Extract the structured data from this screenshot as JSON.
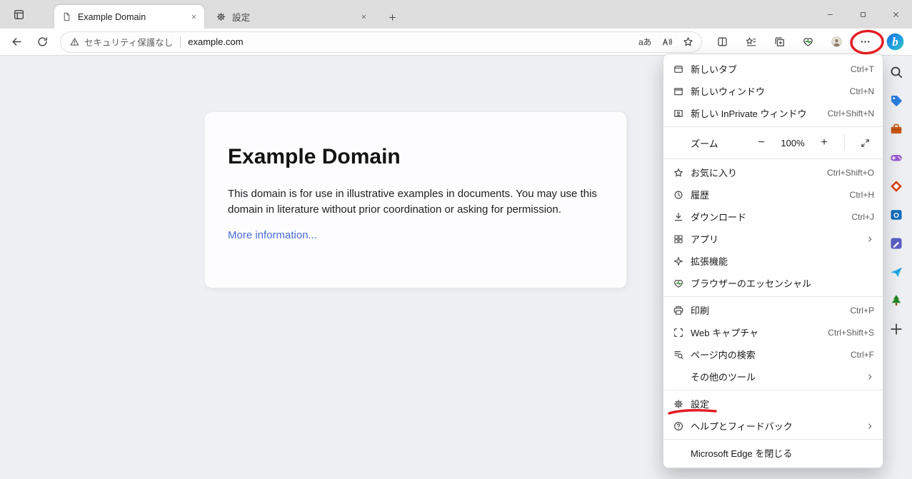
{
  "colors": {
    "annotation_red": "#e31b23",
    "link_blue": "#4a6cd4"
  },
  "titlebar": {
    "tabs": [
      {
        "id": "example-domain",
        "label": "Example Domain",
        "favicon": "page-icon",
        "active": true
      },
      {
        "id": "settings",
        "label": "設定",
        "favicon": "gear-icon",
        "active": false
      }
    ],
    "window_controls": [
      {
        "id": "minimize",
        "icon": "minimize-icon"
      },
      {
        "id": "maximize",
        "icon": "maximize-icon"
      },
      {
        "id": "close",
        "icon": "close-window-icon"
      }
    ]
  },
  "toolbar": {
    "address_bar": {
      "security_label": "セキュリティ保護なし",
      "url": "example.com",
      "inline_buttons": [
        {
          "id": "translate",
          "icon": "translate-icon",
          "label": "aあ"
        },
        {
          "id": "read-aloud",
          "icon": "read-aloud-icon"
        },
        {
          "id": "add-favorite",
          "icon": "favorite-star-icon"
        }
      ]
    },
    "buttons": [
      {
        "id": "split-screen",
        "icon": "split-screen-icon"
      },
      {
        "id": "favorites-hub",
        "icon": "favorites-hub-icon"
      },
      {
        "id": "collections",
        "icon": "collections-icon"
      },
      {
        "id": "browser-essentials",
        "icon": "browser-essentials-icon"
      },
      {
        "id": "profile",
        "icon": "profile-avatar-icon"
      },
      {
        "id": "more-menu",
        "icon": "more-menu-icon"
      }
    ],
    "copilot": {
      "id": "copilot",
      "icon": "copilot-icon"
    }
  },
  "sidebar": {
    "items": [
      {
        "id": "search",
        "icon": "sidebar-search-icon"
      },
      {
        "id": "shopping",
        "icon": "shopping-icon"
      },
      {
        "id": "toolbox",
        "icon": "toolbox-icon"
      },
      {
        "id": "games",
        "icon": "games-icon"
      },
      {
        "id": "microsoft-365",
        "icon": "m365-icon"
      },
      {
        "id": "outlook",
        "icon": "outlook-icon"
      },
      {
        "id": "designer",
        "icon": "designer-icon"
      },
      {
        "id": "drop",
        "icon": "drop-icon"
      },
      {
        "id": "grow-tree",
        "icon": "grow-tree-icon"
      },
      {
        "id": "add",
        "icon": "sidebar-plus-icon"
      }
    ]
  },
  "page": {
    "heading": "Example Domain",
    "body": "This domain is for use in illustrative examples in documents. You may use this domain in literature without prior coordination or asking for permission.",
    "link_label": "More information..."
  },
  "menu": {
    "items": [
      {
        "type": "item",
        "id": "new-tab",
        "icon": "new-tab-icon",
        "label": "新しいタブ",
        "shortcut": "Ctrl+T"
      },
      {
        "type": "item",
        "id": "new-window",
        "icon": "new-window-icon",
        "label": "新しいウィンドウ",
        "shortcut": "Ctrl+N"
      },
      {
        "type": "item",
        "id": "new-inprivate-window",
        "icon": "inprivate-icon",
        "label": "新しい InPrivate ウィンドウ",
        "shortcut": "Ctrl+Shift+N"
      },
      {
        "type": "separator"
      },
      {
        "type": "zoom",
        "id": "zoom",
        "label": "ズーム",
        "minus": "−",
        "zoom_value": "100%",
        "plus": "+",
        "fullscreen_icon": "expand-icon"
      },
      {
        "type": "separator"
      },
      {
        "type": "item",
        "id": "favorites",
        "icon": "favorites-menu-icon",
        "label": "お気に入り",
        "shortcut": "Ctrl+Shift+O"
      },
      {
        "type": "item",
        "id": "history",
        "icon": "history-icon",
        "label": "履歴",
        "shortcut": "Ctrl+H"
      },
      {
        "type": "item",
        "id": "downloads",
        "icon": "download-icon",
        "label": "ダウンロード",
        "shortcut": "Ctrl+J"
      },
      {
        "type": "item",
        "id": "apps",
        "icon": "apps-icon",
        "label": "アプリ",
        "submenu": true
      },
      {
        "type": "item",
        "id": "extensions",
        "icon": "extensions-icon",
        "label": "拡張機能"
      },
      {
        "type": "item",
        "id": "browser-essentials",
        "icon": "essentials-menu-icon",
        "label": "ブラウザーのエッセンシャル"
      },
      {
        "type": "separator"
      },
      {
        "type": "item",
        "id": "print",
        "icon": "print-icon",
        "label": "印刷",
        "shortcut": "Ctrl+P"
      },
      {
        "type": "item",
        "id": "web-capture",
        "icon": "web-capture-icon",
        "label": "Web キャプチャ",
        "shortcut": "Ctrl+Shift+S"
      },
      {
        "type": "item",
        "id": "find-on-page",
        "icon": "find-icon",
        "label": "ページ内の検索",
        "shortcut": "Ctrl+F"
      },
      {
        "type": "item",
        "id": "more-tools",
        "icon": "",
        "label": "その他のツール",
        "submenu": true
      },
      {
        "type": "separator"
      },
      {
        "type": "item",
        "id": "settings",
        "icon": "settings-gear-icon",
        "label": "設定",
        "annotated": true
      },
      {
        "type": "item",
        "id": "help-feedback",
        "icon": "help-icon",
        "label": "ヘルプとフィードバック",
        "submenu": true
      },
      {
        "type": "separator"
      },
      {
        "type": "item",
        "id": "close-edge",
        "icon": "",
        "label": "Microsoft Edge を閉じる"
      }
    ]
  }
}
